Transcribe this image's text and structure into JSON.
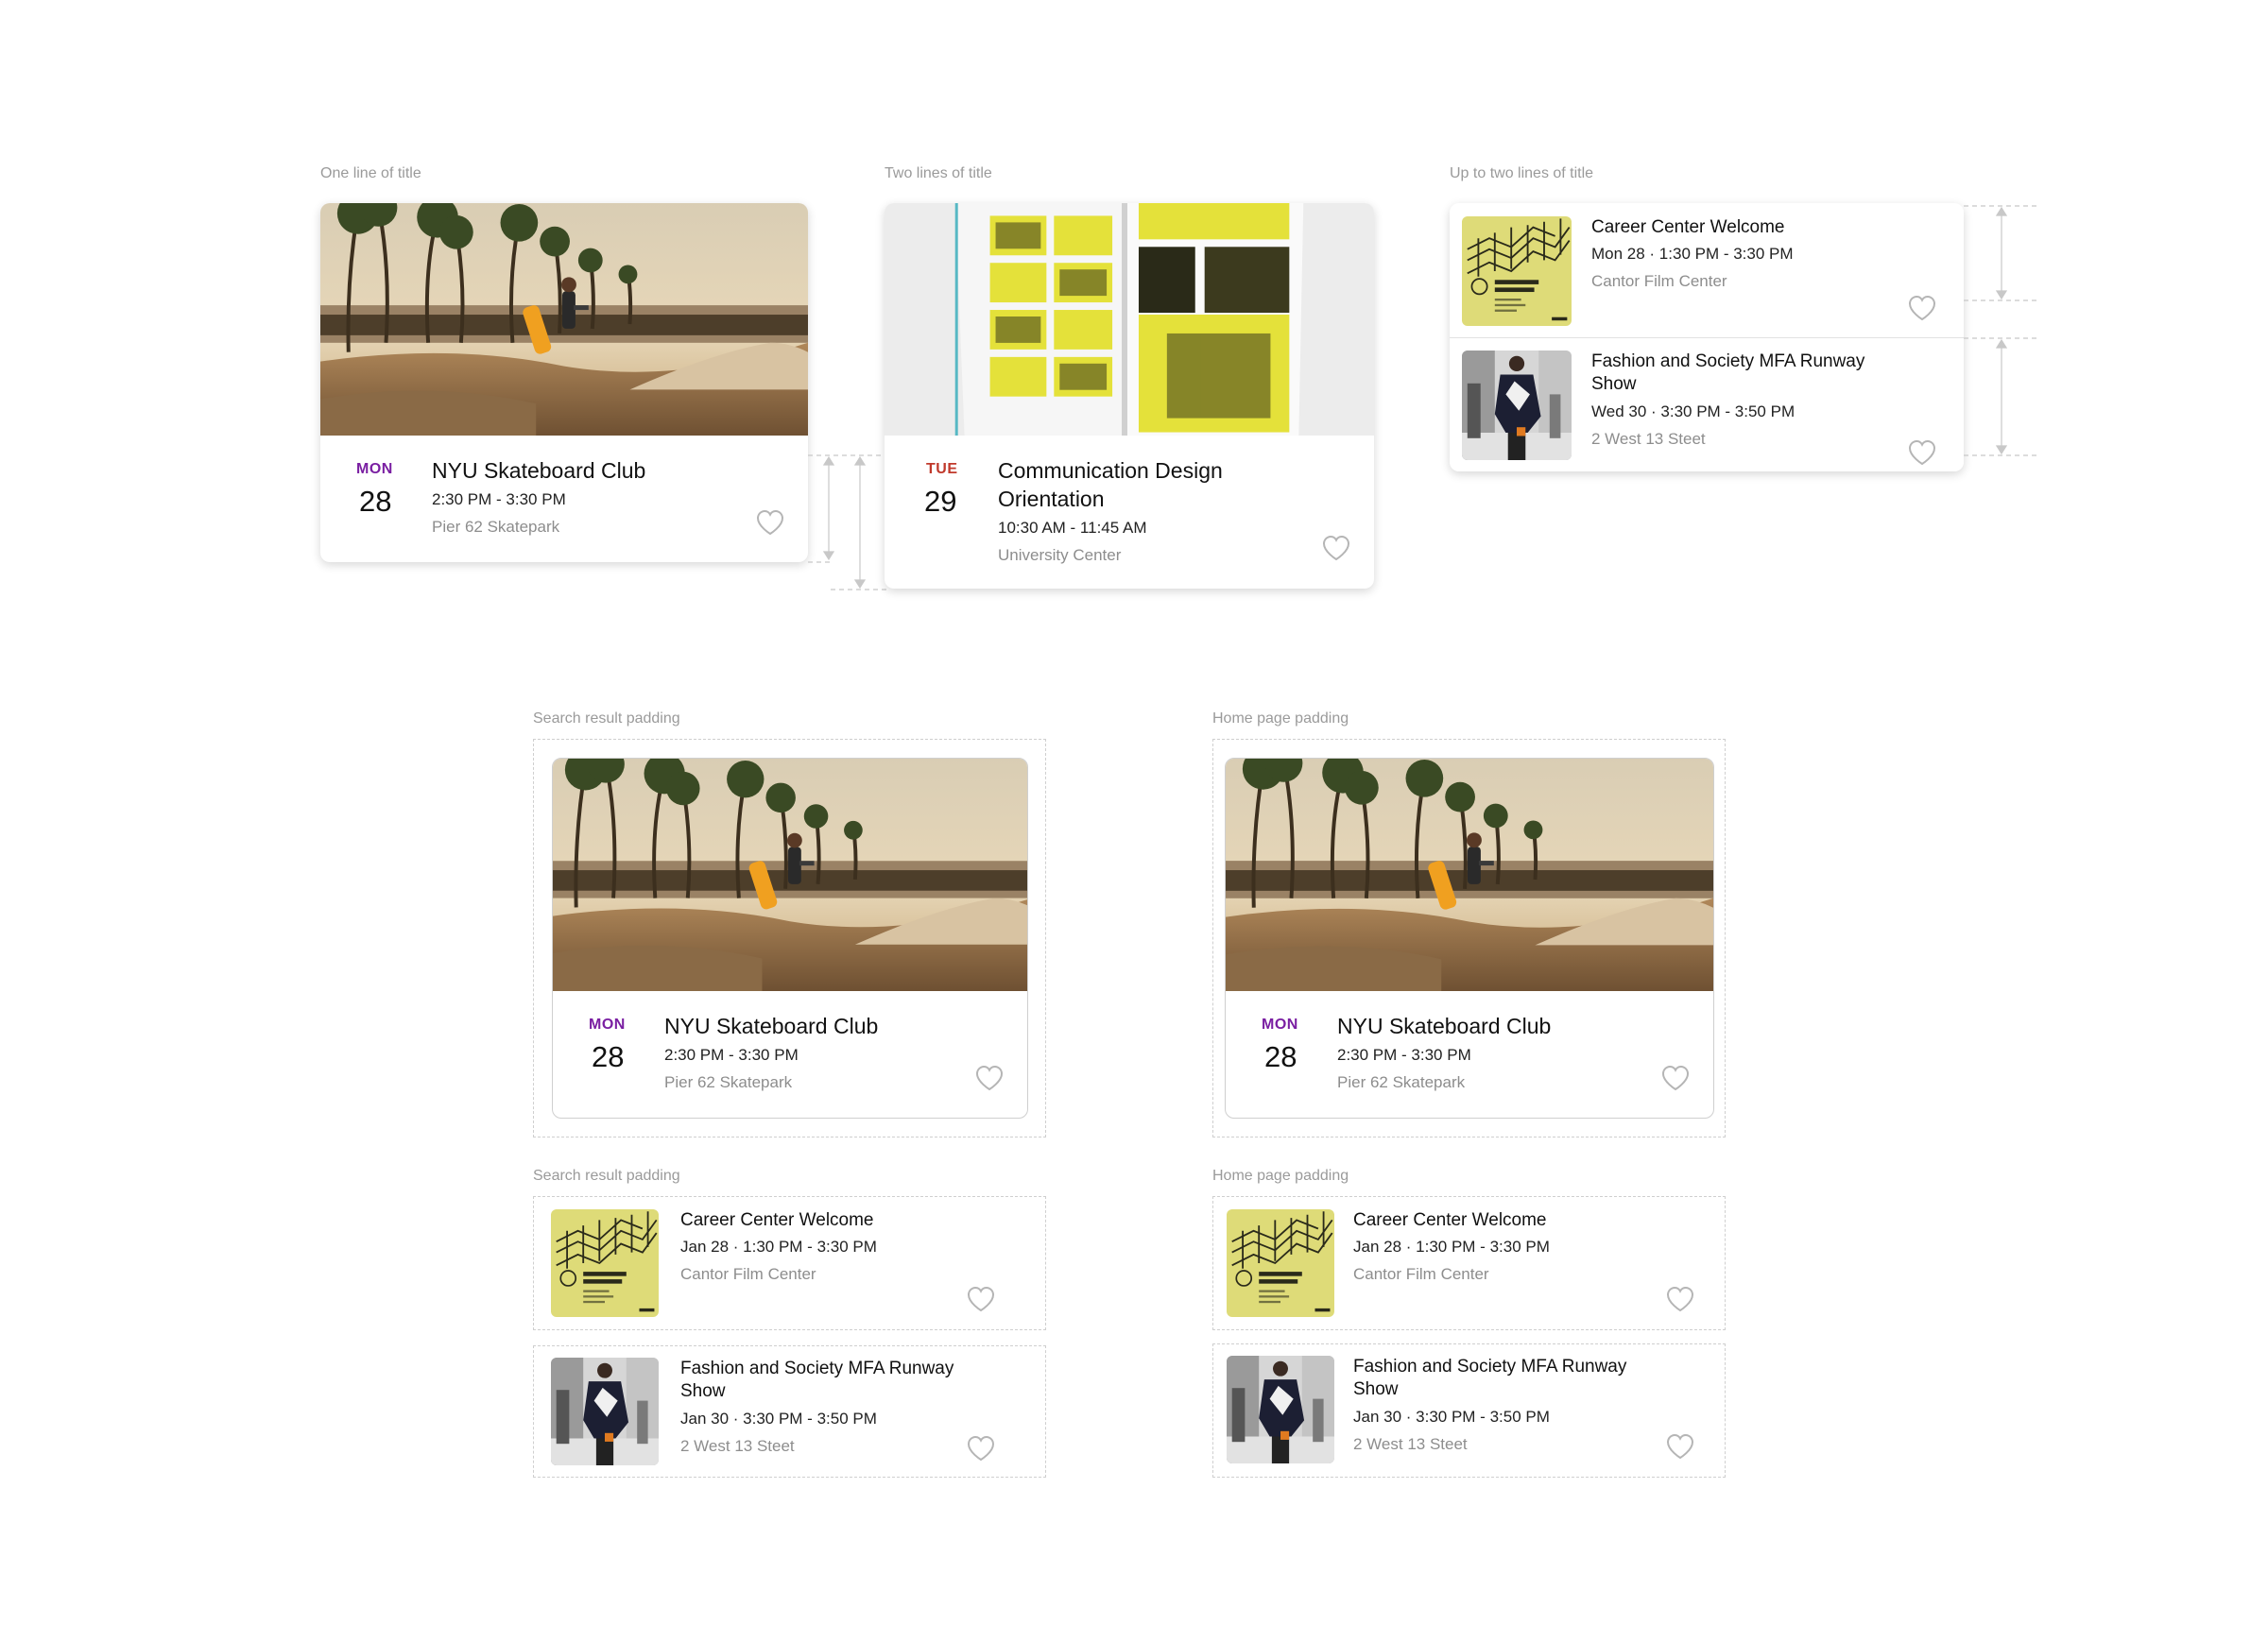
{
  "captions": {
    "one_line": "One line of title",
    "two_lines": "Two lines of title",
    "up_to_two": "Up to two lines of title",
    "search_padding_1": "Search result padding",
    "home_padding_1": "Home page padding",
    "search_padding_2": "Search result padding",
    "home_padding_2": "Home page padding"
  },
  "colors": {
    "mon_accent": "#7a1fa2",
    "tue_accent": "#c0392b",
    "heart_stroke": "#b5b5b5",
    "dashed_border": "#cfcfcf"
  },
  "event_skate": {
    "dow": "MON",
    "day": "28",
    "title": "NYU Skateboard Club",
    "time": "2:30 PM - 3:30 PM",
    "location": "Pier 62 Skatepark",
    "image": "skatepark-photo"
  },
  "event_design": {
    "dow": "TUE",
    "day": "29",
    "title": "Communication Design Orientation",
    "time": "10:30 AM - 11:45 AM",
    "location": "University Center",
    "image": "yellow-magazine-photo"
  },
  "list_top": [
    {
      "title": "Career Center Welcome",
      "meta": "Mon 28 · 1:30 PM - 3:30 PM",
      "location": "Cantor Film Center",
      "image": "social-impact-career-fair-poster"
    },
    {
      "title": "Fashion and Society MFA Runway Show",
      "meta": "Wed 30 · 3:30 PM - 3:50 PM",
      "location": "2 West 13 Steet",
      "image": "runway-model-photo"
    }
  ],
  "list_padded": [
    {
      "title": "Career Center Welcome",
      "meta": "Jan 28 · 1:30 PM - 3:30 PM",
      "location": "Cantor Film Center",
      "image": "social-impact-career-fair-poster"
    },
    {
      "title": "Fashion and Society MFA Runway Show",
      "meta": "Jan 30 · 3:30 PM - 3:50 PM",
      "location": "2 West 13 Steet",
      "image": "runway-model-photo"
    }
  ],
  "poster_text": {
    "line1": "SOCIAL IMPACT",
    "line2": "CAREER FAIR"
  }
}
